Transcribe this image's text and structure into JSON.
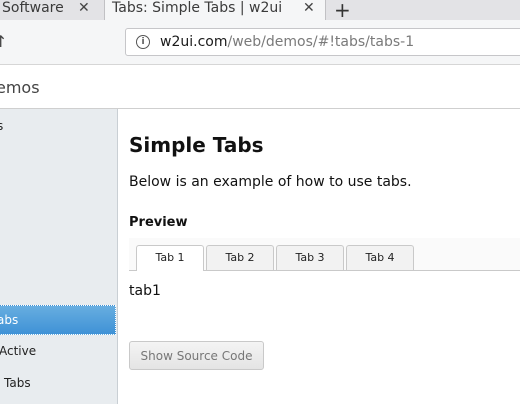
{
  "browser": {
    "tabs": [
      {
        "label": "Software"
      },
      {
        "label": "Tabs: Simple Tabs | w2ui"
      }
    ],
    "new_tab_symbol": "+",
    "close_symbol": "✕",
    "back_symbol": "↑",
    "url": {
      "domain": "w2ui.com",
      "path": "/web/demos/#!tabs/tabs-1"
    }
  },
  "header": {
    "title": "emos"
  },
  "sidebar": {
    "items": [
      {
        "label": "s"
      },
      {
        "label": "abs"
      },
      {
        "label": "Active"
      },
      {
        "label": "Tabs"
      }
    ],
    "selected_index": 1
  },
  "main": {
    "title": "Simple Tabs",
    "description": "Below is an example of how to use tabs.",
    "preview_label": "Preview",
    "tabs": [
      {
        "label": "Tab 1"
      },
      {
        "label": "Tab 2"
      },
      {
        "label": "Tab 3"
      },
      {
        "label": "Tab 4"
      }
    ],
    "active_tab_index": 0,
    "tab_content": "tab1",
    "source_button_label": "Show Source Code"
  },
  "colors": {
    "selection_accent": "#4a9ad9",
    "sidebar_bg": "#e8ecef"
  }
}
